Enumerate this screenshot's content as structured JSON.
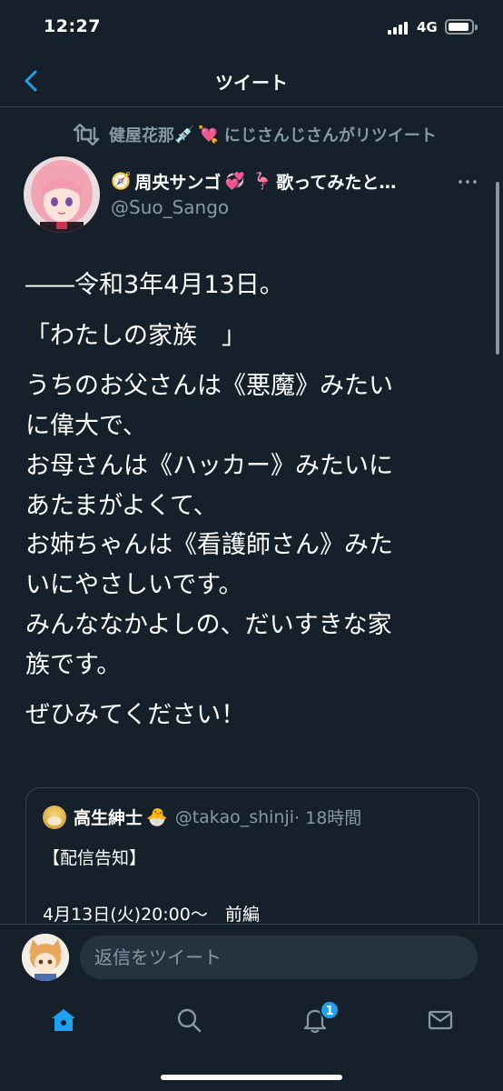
{
  "status_bar": {
    "time": "12:27",
    "network": "4G"
  },
  "header": {
    "title": "ツイート"
  },
  "retweet": {
    "by": "健屋花那",
    "emoji1": "💉",
    "emoji2": "💘",
    "suffix": "にじさんじさんがリツイート"
  },
  "author": {
    "emoji1": "🧭",
    "name": "周央サンゴ",
    "emoji2": "💞",
    "emoji3": "🦩",
    "name_rest": "歌ってみたと…",
    "handle": "@Suo_Sango"
  },
  "tweet": {
    "lines": [
      "――令和3年4月13日。",
      "「わたしの家族　」",
      "うちのお父さんは《悪魔》みたい\nに偉大で、\nお母さんは《ハッカー》みたいに\nあたまがよくて、\nお姉ちゃんは《看護師さん》みた\nいにやさしいです。\nみんななかよしの、だいすきな家\n族です。",
      "ぜひみてください！"
    ]
  },
  "quote": {
    "name": "高生紳士",
    "emoji": "🐣",
    "handle": "@takao_shinji",
    "time": "· 18時間",
    "line1": "【配信告知】",
    "line2": "4月13日(火)20:00〜　前編"
  },
  "reply": {
    "placeholder": "返信をツイート"
  },
  "tabs": {
    "notification_count": "1"
  },
  "colors": {
    "background": "#15202b",
    "accent": "#1da1f2",
    "muted": "#8899a6",
    "border": "#38444d"
  },
  "icons": [
    "back-arrow-icon",
    "retweet-icon",
    "more-icon",
    "home-icon",
    "search-icon",
    "notifications-icon",
    "messages-icon"
  ]
}
